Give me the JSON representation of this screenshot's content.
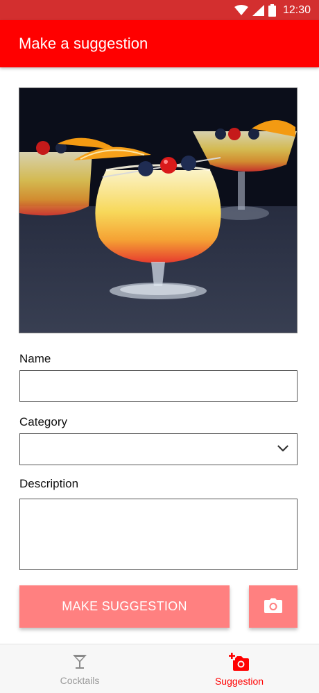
{
  "status_bar": {
    "time": "12:30",
    "icons": [
      "wifi-icon",
      "cellular-signal-icon",
      "battery-icon"
    ]
  },
  "app_bar": {
    "title": "Make a suggestion"
  },
  "form": {
    "photo": {
      "icon": "cocktail-photo"
    },
    "name": {
      "label": "Name",
      "value": "",
      "placeholder": ""
    },
    "category": {
      "label": "Category",
      "selected": ""
    },
    "description": {
      "label": "Description",
      "value": "",
      "placeholder": ""
    },
    "submit_label": "MAKE SUGGESTION",
    "camera_icon": "camera-icon"
  },
  "bottom_nav": {
    "items": [
      {
        "label": "Cocktails",
        "icon": "cocktail-glass-icon",
        "active": false
      },
      {
        "label": "Suggestion",
        "icon": "add-a-photo-icon",
        "active": true
      }
    ]
  },
  "colors": {
    "status_bar": "#d32f2f",
    "app_bar": "#ff0000",
    "button": "#ff8080",
    "nav_active": "#ff0000",
    "nav_inactive": "#9a9a9a"
  }
}
